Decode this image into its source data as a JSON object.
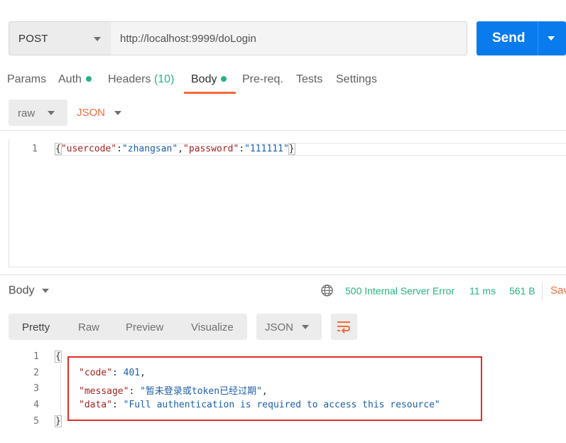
{
  "request": {
    "method": "POST",
    "url": "http://localhost:9999/doLogin",
    "send_label": "Send"
  },
  "request_tabs": {
    "params": "Params",
    "auth": "Auth",
    "headers": "Headers",
    "headers_count": "(10)",
    "body": "Body",
    "prereq": "Pre-req.",
    "tests": "Tests",
    "settings": "Settings",
    "active": "Body"
  },
  "body_mode": {
    "mode": "raw",
    "format": "JSON"
  },
  "request_editor": {
    "line_number": "1",
    "content": {
      "open": "{",
      "k1": "\"usercode\"",
      "colon1": ":",
      "v1": "\"zhangsan\"",
      "comma": ",",
      "k2": "\"password\"",
      "colon2": ":",
      "v2": "\"111111\"",
      "close": "}"
    }
  },
  "response": {
    "body_label": "Body",
    "status": "500 Internal Server Error",
    "time": "11 ms",
    "size": "561 B",
    "save_label": "Sav",
    "view_tabs": [
      "Pretty",
      "Raw",
      "Preview",
      "Visualize"
    ],
    "active_view": "Pretty",
    "format": "JSON",
    "line_numbers": [
      "1",
      "2",
      "3",
      "4",
      "5"
    ],
    "lines": {
      "open": "{",
      "code_key": "\"code\"",
      "code_value": "401",
      "message_key": "\"message\"",
      "message_value": "\"暂未登录或token已经过期\"",
      "data_key": "\"data\"",
      "data_value": "\"Full authentication is required to access this resource\"",
      "close": "}"
    }
  },
  "colors": {
    "accent": "#097bed",
    "brand_orange": "#f26b3a",
    "success_green": "#26b47f",
    "highlight_box": "#e12a2a"
  },
  "icons": [
    "caret-down-icon",
    "globe-icon",
    "word-wrap-icon"
  ]
}
